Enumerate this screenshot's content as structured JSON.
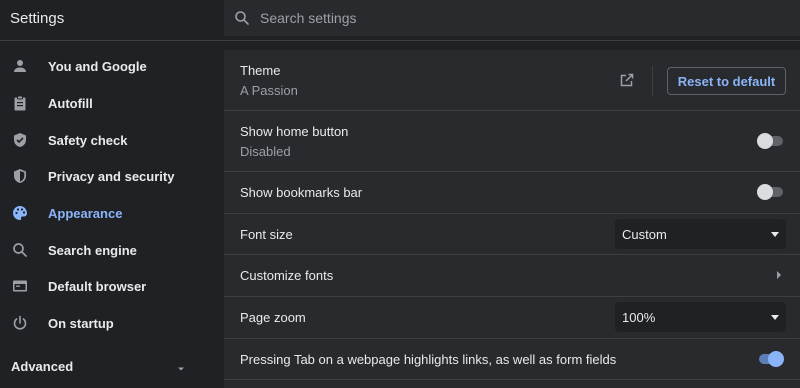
{
  "app": {
    "title": "Settings"
  },
  "search": {
    "placeholder": "Search settings"
  },
  "sidebar": {
    "items": [
      {
        "label": "You and Google",
        "icon": "person-icon",
        "active": false
      },
      {
        "label": "Autofill",
        "icon": "clipboard-icon",
        "active": false
      },
      {
        "label": "Safety check",
        "icon": "shield-check-icon",
        "active": false
      },
      {
        "label": "Privacy and security",
        "icon": "shield-icon",
        "active": false
      },
      {
        "label": "Appearance",
        "icon": "palette-icon",
        "active": true
      },
      {
        "label": "Search engine",
        "icon": "search-icon",
        "active": false
      },
      {
        "label": "Default browser",
        "icon": "browser-window-icon",
        "active": false
      },
      {
        "label": "On startup",
        "icon": "power-icon",
        "active": false
      }
    ],
    "advanced": {
      "label": "Advanced"
    }
  },
  "settings": {
    "theme": {
      "title": "Theme",
      "value": "A Passion",
      "reset_label": "Reset to default"
    },
    "home_button": {
      "title": "Show home button",
      "value": "Disabled",
      "enabled": false
    },
    "bookmarks_bar": {
      "title": "Show bookmarks bar",
      "enabled": false
    },
    "font_size": {
      "title": "Font size",
      "value": "Custom"
    },
    "customize_fonts": {
      "title": "Customize fonts"
    },
    "page_zoom": {
      "title": "Page zoom",
      "value": "100%"
    },
    "tab_highlight": {
      "title": "Pressing Tab on a webpage highlights links, as well as form fields",
      "enabled": true
    }
  },
  "colors": {
    "background": "#202124",
    "card": "#292a2d",
    "accent": "#8ab4f8",
    "text": "#e8eaed",
    "secondary_text": "#9aa0a6"
  }
}
